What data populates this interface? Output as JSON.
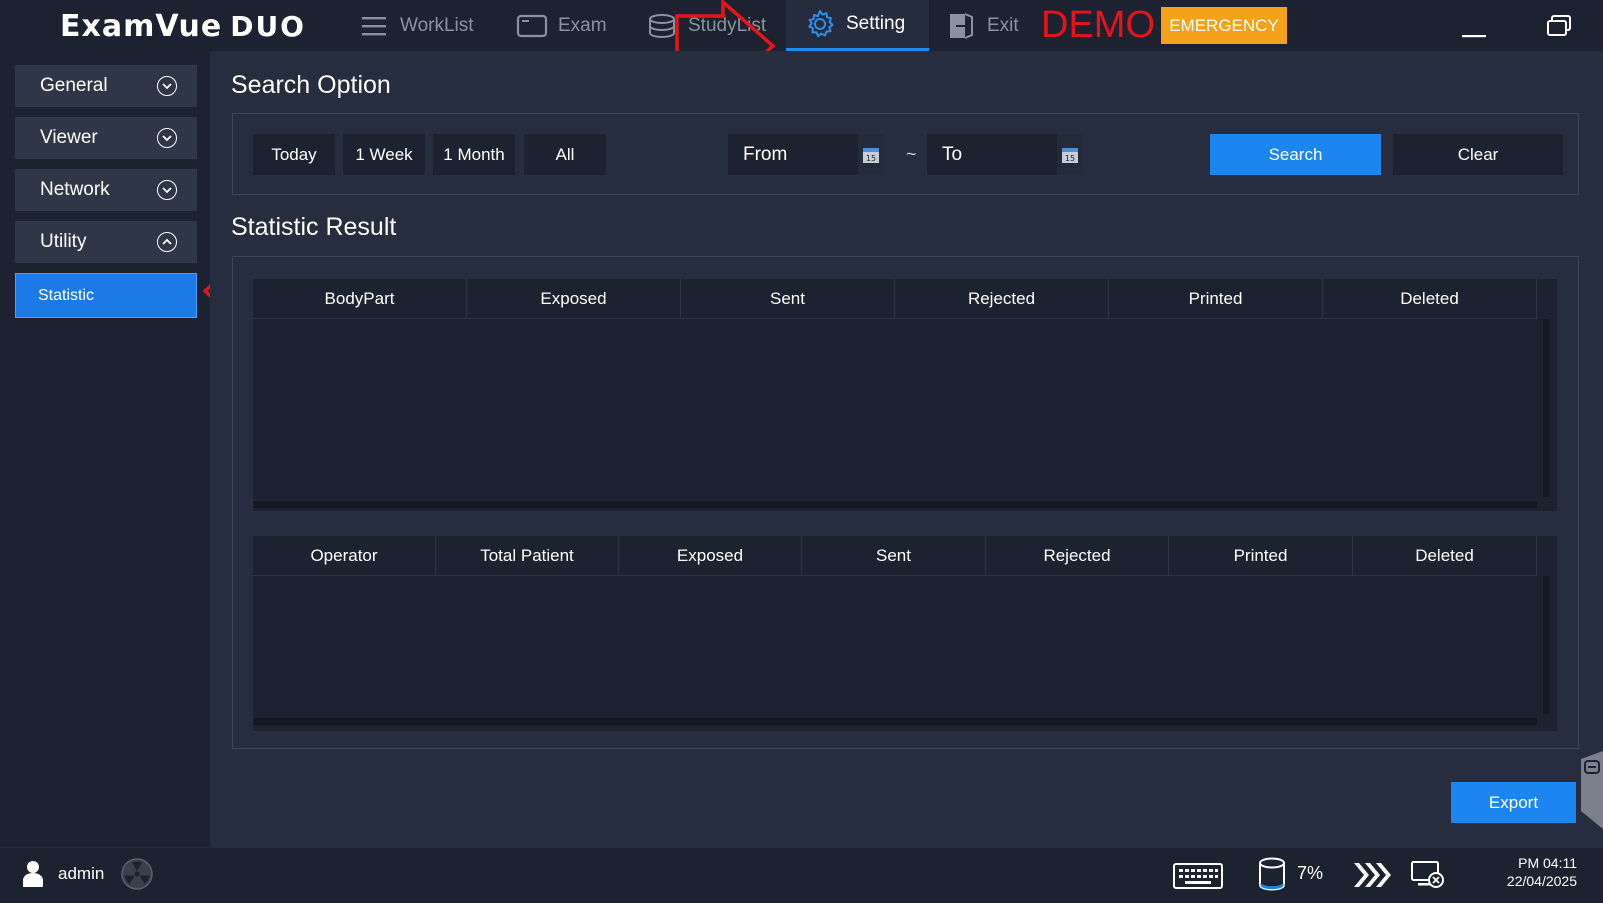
{
  "app": {
    "logo_main": "ExamVue",
    "logo_sub": "DUO",
    "demo_label": "DEMO",
    "emergency_label": "EMERGENCY"
  },
  "nav": {
    "worklist": "WorkList",
    "exam": "Exam",
    "studylist": "StudyList",
    "setting": "Setting",
    "exit": "Exit"
  },
  "sidebar": {
    "items": [
      {
        "label": "General",
        "state": "collapsed"
      },
      {
        "label": "Viewer",
        "state": "collapsed"
      },
      {
        "label": "Network",
        "state": "collapsed"
      },
      {
        "label": "Utility",
        "state": "expanded"
      }
    ],
    "sub_items": [
      {
        "label": "Statistic",
        "selected": true
      }
    ]
  },
  "search_option": {
    "title": "Search Option",
    "quick_ranges": [
      "Today",
      "1 Week",
      "1 Month",
      "All"
    ],
    "from_placeholder": "From",
    "to_placeholder": "To",
    "range_separator": "~",
    "calendar_day": "15",
    "search_label": "Search",
    "clear_label": "Clear"
  },
  "statistic_result": {
    "title": "Statistic Result",
    "bodypart_columns": [
      "BodyPart",
      "Exposed",
      "Sent",
      "Rejected",
      "Printed",
      "Deleted"
    ],
    "operator_columns": [
      "Operator",
      "Total Patient",
      "Exposed",
      "Sent",
      "Rejected",
      "Printed",
      "Deleted"
    ],
    "bodypart_rows": [],
    "operator_rows": []
  },
  "export_label": "Export",
  "status": {
    "user": "admin",
    "disk_usage": "7%",
    "time": "PM 04:11",
    "date": "22/04/2025"
  },
  "colors": {
    "accent": "#1b86f0",
    "emergency": "#f5a11a",
    "demo": "#e8131a",
    "annotation_arrow": "#e8131a"
  }
}
